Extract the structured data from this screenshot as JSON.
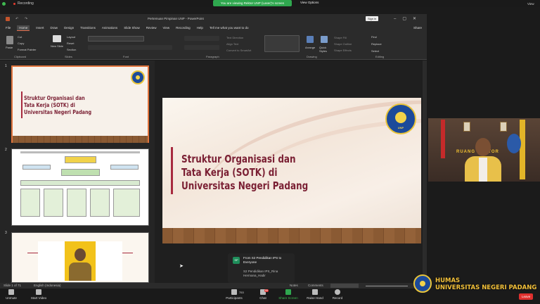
{
  "zoom": {
    "recording_label": "Recording",
    "viewing_banner": "You are viewing Rektor UNP (Laser)'s screen",
    "view_options": "View Options",
    "view_label": "View",
    "toolbar": [
      {
        "label": "Unmute"
      },
      {
        "label": "Start Video"
      },
      {
        "label": "Participants",
        "count": "753"
      },
      {
        "label": "Chat",
        "badge": "99"
      },
      {
        "label": "Share Screen"
      },
      {
        "label": "Raise Hand"
      },
      {
        "label": "Record"
      }
    ],
    "leave_label": "Leave",
    "chat_popup": {
      "avatar": "SP",
      "title": "From S2 Pendidikan IPS to Everyone",
      "message": "S2 Pendidikan IPS_Rina Hermana_Hadir"
    }
  },
  "ppt": {
    "window_title": "Pertemuan Pimpinan UNP - PowerPoint",
    "sign_in": "Sign in",
    "menu": [
      "File",
      "Home",
      "Insert",
      "Draw",
      "Design",
      "Transitions",
      "Animations",
      "Slide Show",
      "Review",
      "View",
      "Recording",
      "Help",
      "Tell me what you want to do"
    ],
    "active_menu": "Home",
    "share": "Share",
    "ribbon": {
      "clipboard": {
        "label": "Clipboard",
        "paste": "Paste",
        "cut": "Cut",
        "copy": "Copy",
        "format_painter": "Format Painter"
      },
      "slides": {
        "label": "Slides",
        "new_slide": "New Slide",
        "layout": "Layout",
        "reset": "Reset",
        "section": "Section"
      },
      "font_label": "Font",
      "paragraph_label": "Paragraph",
      "drawing": {
        "label": "Drawing",
        "arrange": "Arrange",
        "quick_styles": "Quick Styles",
        "shape_fill": "Shape Fill",
        "shape_outline": "Shape Outline",
        "shape_effects": "Shape Effects"
      },
      "editing": {
        "label": "Editing",
        "find": "Find",
        "replace": "Replace",
        "select": "Select"
      },
      "text_direction": "Text Direction",
      "align_text": "Align Text",
      "convert_smartart": "Convert to SmartArt"
    },
    "thumbnails": [
      "1",
      "2",
      "3"
    ],
    "slide": {
      "title_lines": [
        "Struktur Organisasi dan",
        "Tata Kerja (SOTK) di",
        "Universitas Negeri Padang"
      ],
      "logo_text": "UNIVERSITAS NEGERI PADANG",
      "logo_label": "UNP"
    },
    "status": {
      "slide_counter": "Slide 1 of 71",
      "language": "English (Indonesia)",
      "notes": "Notes",
      "comments": "Comments"
    }
  },
  "video": {
    "backdrop_text": "RUANG REKTOR"
  },
  "watermark": [
    "HUMAS",
    "UNIVERSITAS NEGERI PADANG"
  ],
  "colors": {
    "title_maroon": "#7a1f33",
    "accent_orange": "#e0733c",
    "share_green": "#2fa84f",
    "leave_red": "#e0302e",
    "humas_gold": "#f3c13a"
  }
}
